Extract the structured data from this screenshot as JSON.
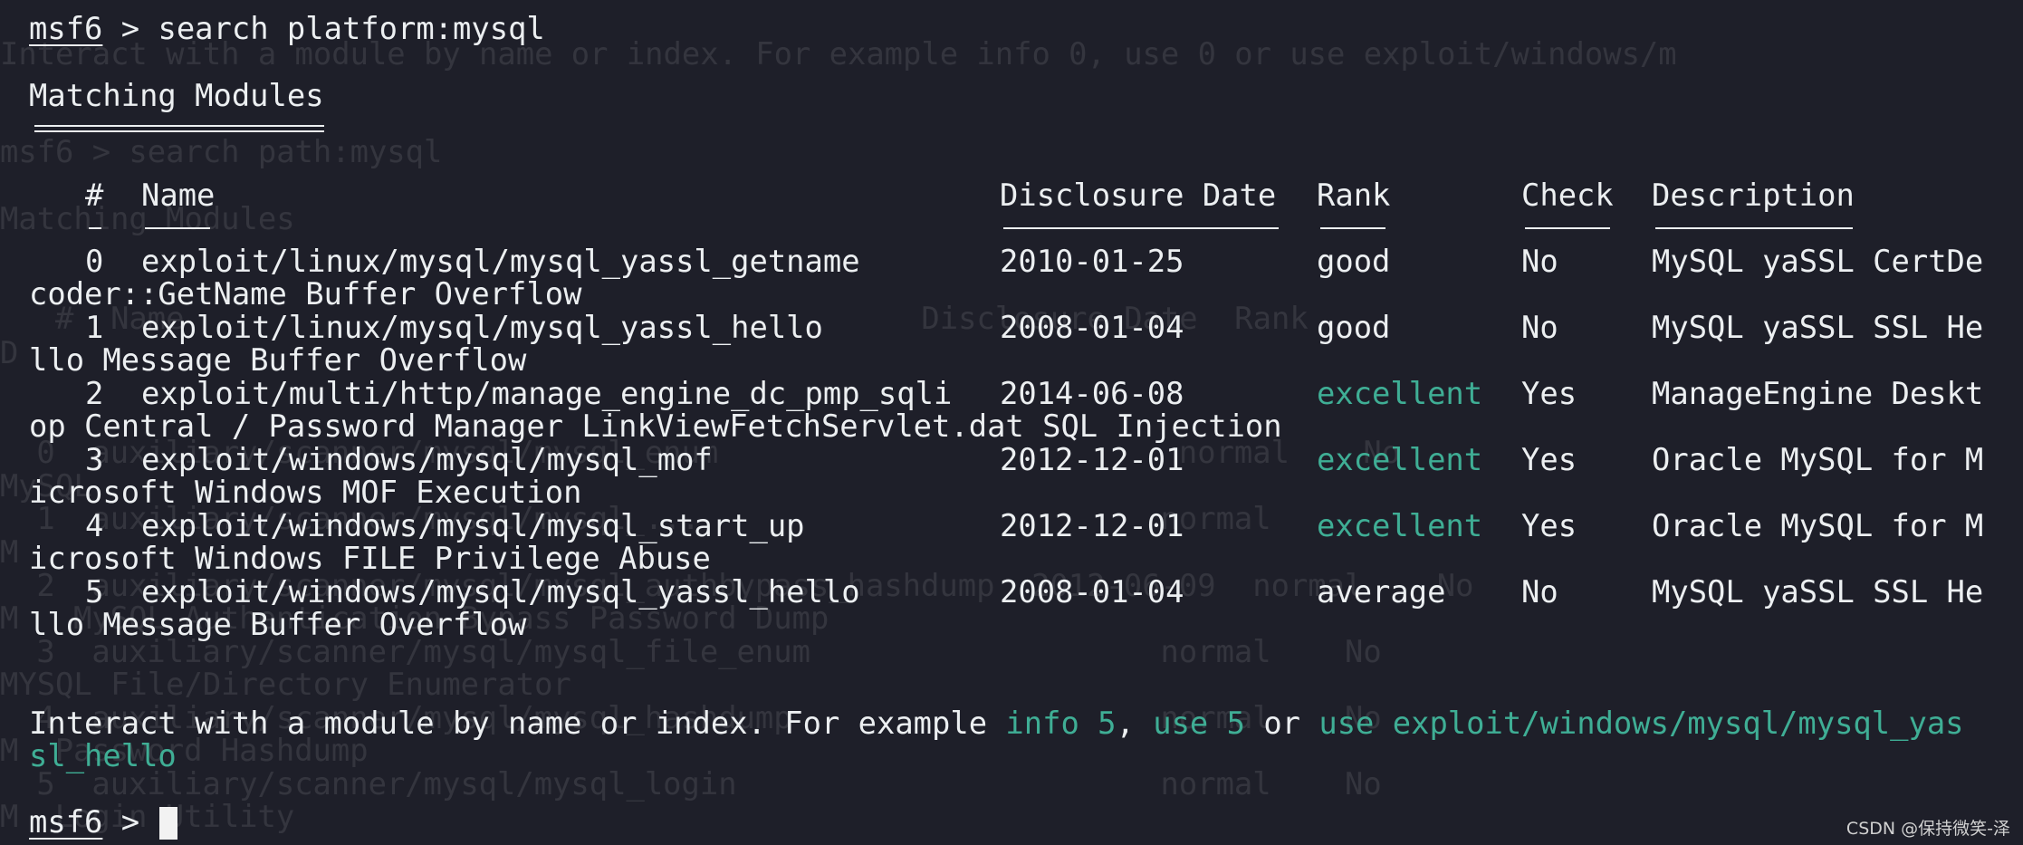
{
  "prompt_label": "msf6",
  "prompt_symbol": ">",
  "command": "search platform:mysql",
  "heading": "Matching Modules",
  "columns": {
    "index": "#",
    "name": "Name",
    "date": "Disclosure Date",
    "rank": "Rank",
    "check": "Check",
    "description": "Description"
  },
  "rows": [
    {
      "index": "0",
      "name": "exploit/linux/mysql/mysql_yassl_getname",
      "date": "2010-01-25",
      "rank": "good",
      "check": "No",
      "desc_head": "MySQL yaSSL CertDe",
      "desc_tail": "coder::GetName Buffer Overflow"
    },
    {
      "index": "1",
      "name": "exploit/linux/mysql/mysql_yassl_hello",
      "date": "2008-01-04",
      "rank": "good",
      "check": "No",
      "desc_head": "MySQL yaSSL SSL He",
      "desc_tail": "llo Message Buffer Overflow"
    },
    {
      "index": "2",
      "name": "exploit/multi/http/manage_engine_dc_pmp_sqli",
      "date": "2014-06-08",
      "rank": "excellent",
      "check": "Yes",
      "desc_head": "ManageEngine Deskt",
      "desc_tail": "op Central / Password Manager LinkViewFetchServlet.dat SQL Injection"
    },
    {
      "index": "3",
      "name": "exploit/windows/mysql/mysql_mof",
      "date": "2012-12-01",
      "rank": "excellent",
      "check": "Yes",
      "desc_head": "Oracle MySQL for M",
      "desc_tail": "icrosoft Windows MOF Execution"
    },
    {
      "index": "4",
      "name": "exploit/windows/mysql/mysql_start_up",
      "date": "2012-12-01",
      "rank": "excellent",
      "check": "Yes",
      "desc_head": "Oracle MySQL for M",
      "desc_tail": "icrosoft Windows FILE Privilege Abuse"
    },
    {
      "index": "5",
      "name": "exploit/windows/mysql/mysql_yassl_hello",
      "date": "2008-01-04",
      "rank": "average",
      "check": "No",
      "desc_head": "MySQL yaSSL SSL He",
      "desc_tail": "llo Message Buffer Overflow"
    }
  ],
  "footer": {
    "text_a": "Interact with a module by name or index. For example ",
    "hint_info": "info 5",
    "text_b": ", ",
    "hint_use": "use 5",
    "text_c": " or ",
    "hint_use_path_head": "use exploit/windows/mysql/mysql_yas",
    "hint_use_path_tail": "sl_hello"
  },
  "colors": {
    "background": "#1e1f29",
    "text": "#eceff1",
    "accent_teal": "#3fae95"
  },
  "watermark": "CSDN @保持微笑-泽",
  "background_ghost": {
    "line_interact": "Interact with a module by name or index. For example info 0, use 0 or use exploit/windows/m",
    "line_search": "msf6 > search path:mysql",
    "line_matching": "Matching Modules",
    "line_hdr": "   #  Name                                        Disclosure Date  Rank",
    "line_d": "D",
    "line_row0": " 0  auxiliary/scanner/mysql/mysql_enum                         normal    No",
    "line_mysq": "MySQL",
    "line_row1": " 1  auxiliary/scanner/mysql/mysql_...                         normal",
    "line_m1": "M",
    "line_row2": " 2  auxiliary/scanner/mysql/mysql_authbypass_hashdump  2012-06-09  normal    No",
    "line_m2": "M",
    "line_hash": "   MySQL Authentication Bypass Password Dump",
    "line_row3": " 3  auxiliary/scanner/mysql/mysql_file_enum                   normal    No",
    "line_file": "MYSQL File/Directory Enumerator",
    "line_row4": " 4  auxiliary/scanner/mysql/mysql_hashdump                    normal    No",
    "line_m3": "M",
    "line_pwd": "  Password Hashdump",
    "line_row5": " 5  auxiliary/scanner/mysql/mysql_login                       normal    No",
    "line_m4": "M",
    "line_login": "  Login Utility"
  }
}
